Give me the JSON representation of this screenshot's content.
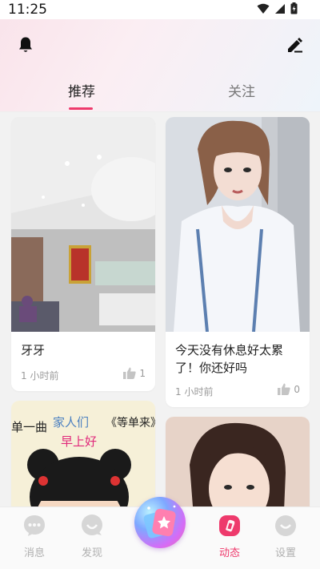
{
  "status_bar": {
    "time": "11:25"
  },
  "header": {
    "tabs": [
      {
        "label": "推荐",
        "active": true
      },
      {
        "label": "关注",
        "active": false
      }
    ],
    "left_icon": "bell-icon",
    "right_icon": "edit-icon"
  },
  "feed": {
    "cards": [
      {
        "title": "牙牙",
        "time": "1 小时前",
        "likes": "1"
      },
      {
        "title": "今天没有休息好太累了！你还好吗",
        "time": "1 小时前",
        "likes": "0"
      },
      {
        "photo_text_1": "单一曲",
        "photo_text_2": "家人们",
        "photo_text_3": "早上好",
        "photo_text_4": "《等单来》"
      },
      {}
    ]
  },
  "bottom_nav": {
    "items": [
      {
        "label": "消息",
        "icon": "message-icon",
        "active": false
      },
      {
        "label": "发现",
        "icon": "discover-icon",
        "active": false
      },
      {
        "label": "动态",
        "icon": "feed-icon",
        "active": true
      },
      {
        "label": "设置",
        "icon": "settings-icon",
        "active": false
      }
    ],
    "center_icon": "publish-icon"
  },
  "colors": {
    "accent": "#ee3a6c",
    "inactive": "#b0b0b0"
  }
}
